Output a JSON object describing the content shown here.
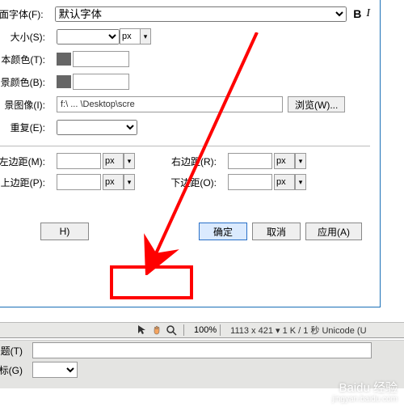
{
  "labels": {
    "font": "面字体(F):",
    "size": "大小(S):",
    "text_color": "本颜色(T):",
    "bg_color": "景颜色(B):",
    "bg_image": "景图像(I):",
    "repeat": "重复(E):",
    "left_margin": "左边距(M):",
    "right_margin": "右边距(R):",
    "top_margin": "上边距(P):",
    "bottom_margin": "下边距(O):",
    "title": "题(T)",
    "target": "标(G)"
  },
  "values": {
    "font": "默认字体",
    "unit_px": "px",
    "bg_image_path": "f:\\ ... \\Desktop\\scre",
    "zoom": "100%",
    "status": "1113 x 421 ▾  1 K / 1 秒  Unicode (U"
  },
  "buttons": {
    "browse": "浏览(W)...",
    "help": "H)",
    "ok": "确定",
    "cancel": "取消",
    "apply": "应用(A)"
  },
  "style": {
    "bold": "B",
    "italic": "I"
  },
  "watermark": {
    "brand": "Baidu 经验",
    "sub": "jingyan.baidu.com"
  }
}
